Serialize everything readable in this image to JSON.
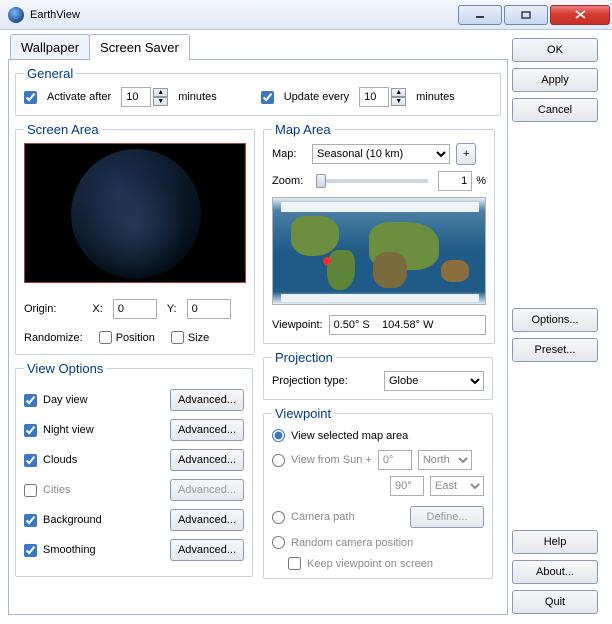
{
  "window": {
    "title": "EarthView"
  },
  "tabs": {
    "wallpaper": "Wallpaper",
    "screensaver": "Screen Saver"
  },
  "general": {
    "legend": "General",
    "activate_after_label": "Activate after",
    "activate_after_value": "10",
    "activate_after_units": "minutes",
    "update_every_label": "Update every",
    "update_every_value": "10",
    "update_every_units": "minutes"
  },
  "screenarea": {
    "legend": "Screen Area",
    "origin_label": "Origin:",
    "x_label": "X:",
    "x_value": "0",
    "y_label": "Y:",
    "y_value": "0",
    "randomize_label": "Randomize:",
    "position_label": "Position",
    "size_label": "Size"
  },
  "viewoptions": {
    "legend": "View Options",
    "items": [
      {
        "label": "Day view",
        "checked": true,
        "enabled": true
      },
      {
        "label": "Night view",
        "checked": true,
        "enabled": true
      },
      {
        "label": "Clouds",
        "checked": true,
        "enabled": true
      },
      {
        "label": "Cities",
        "checked": false,
        "enabled": false
      },
      {
        "label": "Background",
        "checked": true,
        "enabled": true
      },
      {
        "label": "Smoothing",
        "checked": true,
        "enabled": true
      }
    ],
    "advanced_label": "Advanced..."
  },
  "maparea": {
    "legend": "Map Area",
    "map_label": "Map:",
    "map_value": "Seasonal (10 km)",
    "add_label": "+",
    "zoom_label": "Zoom:",
    "zoom_value": "1",
    "zoom_units": "%",
    "viewpoint_label": "Viewpoint:",
    "viewpoint_value": "0.50° S    104.58° W"
  },
  "projection": {
    "legend": "Projection",
    "type_label": "Projection type:",
    "type_value": "Globe"
  },
  "viewpoint": {
    "legend": "Viewpoint",
    "opt_selected": "View selected map area",
    "opt_sun": "View from Sun +",
    "sun_lat": "0°",
    "sun_lat_dir": "North",
    "sun_lon": "90°",
    "sun_lon_dir": "East",
    "opt_camera": "Camera path",
    "define_label": "Define...",
    "opt_random": "Random camera position",
    "keep_label": "Keep viewpoint on screen"
  },
  "buttons": {
    "ok": "OK",
    "apply": "Apply",
    "cancel": "Cancel",
    "options": "Options...",
    "preset": "Preset...",
    "help": "Help",
    "about": "About...",
    "quit": "Quit"
  }
}
